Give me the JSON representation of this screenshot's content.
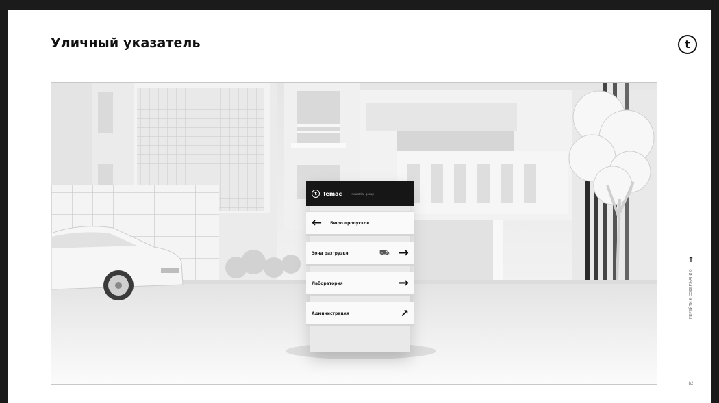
{
  "page": {
    "title": "Уличный указатель",
    "logo_letter": "t"
  },
  "sign": {
    "brand": "Temac",
    "brand_sub": "industrial group",
    "panels": [
      {
        "label": "Бюро пропусков",
        "arrow": "←",
        "direction": "left"
      },
      {
        "label": "Зона разгрузки",
        "arrow": "→",
        "direction": "right",
        "icon": "truck-icon"
      },
      {
        "label": "Лаборатория",
        "arrow": "→",
        "direction": "right"
      },
      {
        "label": "Администрация",
        "arrow": "↗",
        "direction": "up-right"
      }
    ]
  },
  "side_nav": {
    "arrow": "↑",
    "label": "ПЕРЕЙТИ К СОДЕРЖАНИЮ",
    "page_number": "82"
  },
  "colors": {
    "frame": "#1b1b1b",
    "page": "#ffffff",
    "sign_header": "#161616"
  }
}
